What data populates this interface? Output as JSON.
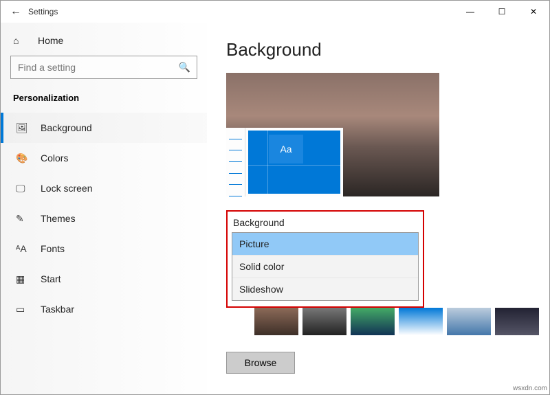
{
  "window": {
    "title": "Settings",
    "back_icon": "←",
    "minimize": "—",
    "maximize": "☐",
    "close": "✕"
  },
  "sidebar": {
    "home_label": "Home",
    "home_icon": "⌂",
    "search_placeholder": "Find a setting",
    "search_icon": "🔍",
    "category": "Personalization",
    "items": [
      {
        "icon": "🖼",
        "label": "Background"
      },
      {
        "icon": "🎨",
        "label": "Colors"
      },
      {
        "icon": "🖵",
        "label": "Lock screen"
      },
      {
        "icon": "✎",
        "label": "Themes"
      },
      {
        "icon": "ᴬA",
        "label": "Fonts"
      },
      {
        "icon": "▦",
        "label": "Start"
      },
      {
        "icon": "▭",
        "label": "Taskbar"
      }
    ]
  },
  "main": {
    "title": "Background",
    "preview_tile_text": "Aa",
    "background_label": "Background",
    "dropdown_options": [
      "Picture",
      "Solid color",
      "Slideshow"
    ],
    "dropdown_selected": "Picture",
    "browse_label": "Browse"
  },
  "watermark": "wsxdn.com"
}
